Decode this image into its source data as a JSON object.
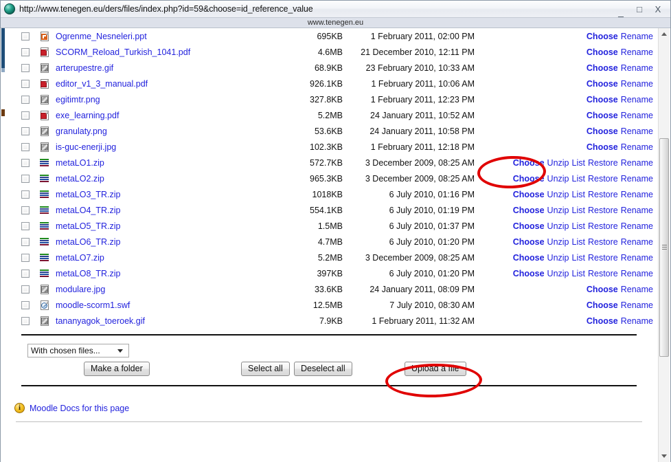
{
  "browser": {
    "favicon": "globe-orb-icon",
    "url": "http://www.tenegen.eu/ders/files/index.php?id=59&choose=id_reference_value",
    "host_strip": "www.tenegen.eu",
    "controls": {
      "minimize": "_",
      "maximize": "□",
      "close": "X"
    }
  },
  "files": [
    {
      "name": "Ogrenme_Nesneleri.ppt",
      "icon": "powerpoint-file-icon",
      "type": "ppt",
      "size": "695KB",
      "date": "1 February 2011, 02:00 PM",
      "actions": [
        "Choose",
        "Rename"
      ]
    },
    {
      "name": "SCORM_Reload_Turkish_1041.pdf",
      "icon": "pdf-file-icon",
      "type": "pdf",
      "size": "4.6MB",
      "date": "21 December 2010, 12:11 PM",
      "actions": [
        "Choose",
        "Rename"
      ]
    },
    {
      "name": "arterupestre.gif",
      "icon": "image-file-icon",
      "type": "img",
      "size": "68.9KB",
      "date": "23 February 2010, 10:33 AM",
      "actions": [
        "Choose",
        "Rename"
      ]
    },
    {
      "name": "editor_v1_3_manual.pdf",
      "icon": "pdf-file-icon",
      "type": "pdf",
      "size": "926.1KB",
      "date": "1 February 2011, 10:06 AM",
      "actions": [
        "Choose",
        "Rename"
      ]
    },
    {
      "name": "egitimtr.png",
      "icon": "image-file-icon",
      "type": "img",
      "size": "327.8KB",
      "date": "1 February 2011, 12:23 PM",
      "actions": [
        "Choose",
        "Rename"
      ]
    },
    {
      "name": "exe_learning.pdf",
      "icon": "pdf-file-icon",
      "type": "pdf",
      "size": "5.2MB",
      "date": "24 January 2011, 10:52 AM",
      "actions": [
        "Choose",
        "Rename"
      ]
    },
    {
      "name": "granulaty.png",
      "icon": "image-file-icon",
      "type": "img",
      "size": "53.6KB",
      "date": "24 January 2011, 10:58 PM",
      "actions": [
        "Choose",
        "Rename"
      ]
    },
    {
      "name": "is-guc-enerji.jpg",
      "icon": "image-file-icon",
      "type": "img",
      "size": "102.3KB",
      "date": "1 February 2011, 12:18 PM",
      "actions": [
        "Choose",
        "Rename"
      ]
    },
    {
      "name": "metaLO1.zip",
      "icon": "zip-file-icon",
      "type": "zip",
      "size": "572.7KB",
      "date": "3 December 2009, 08:25 AM",
      "actions": [
        "Choose",
        "Unzip",
        "List",
        "Restore",
        "Rename"
      ]
    },
    {
      "name": "metaLO2.zip",
      "icon": "zip-file-icon",
      "type": "zip",
      "size": "965.3KB",
      "date": "3 December 2009, 08:25 AM",
      "actions": [
        "Choose",
        "Unzip",
        "List",
        "Restore",
        "Rename"
      ]
    },
    {
      "name": "metaLO3_TR.zip",
      "icon": "zip-file-icon",
      "type": "zip",
      "size": "1018KB",
      "date": "6 July 2010, 01:16 PM",
      "actions": [
        "Choose",
        "Unzip",
        "List",
        "Restore",
        "Rename"
      ]
    },
    {
      "name": "metaLO4_TR.zip",
      "icon": "zip-file-icon",
      "type": "zip",
      "size": "554.1KB",
      "date": "6 July 2010, 01:19 PM",
      "actions": [
        "Choose",
        "Unzip",
        "List",
        "Restore",
        "Rename"
      ]
    },
    {
      "name": "metaLO5_TR.zip",
      "icon": "zip-file-icon",
      "type": "zip",
      "size": "1.5MB",
      "date": "6 July 2010, 01:37 PM",
      "actions": [
        "Choose",
        "Unzip",
        "List",
        "Restore",
        "Rename"
      ]
    },
    {
      "name": "metaLO6_TR.zip",
      "icon": "zip-file-icon",
      "type": "zip",
      "size": "4.7MB",
      "date": "6 July 2010, 01:20 PM",
      "actions": [
        "Choose",
        "Unzip",
        "List",
        "Restore",
        "Rename"
      ]
    },
    {
      "name": "metaLO7.zip",
      "icon": "zip-file-icon",
      "type": "zip",
      "size": "5.2MB",
      "date": "3 December 2009, 08:25 AM",
      "actions": [
        "Choose",
        "Unzip",
        "List",
        "Restore",
        "Rename"
      ]
    },
    {
      "name": "metaLO8_TR.zip",
      "icon": "zip-file-icon",
      "type": "zip",
      "size": "397KB",
      "date": "6 July 2010, 01:20 PM",
      "actions": [
        "Choose",
        "Unzip",
        "List",
        "Restore",
        "Rename"
      ]
    },
    {
      "name": "modulare.jpg",
      "icon": "image-file-icon",
      "type": "img",
      "size": "33.6KB",
      "date": "24 January 2011, 08:09 PM",
      "actions": [
        "Choose",
        "Rename"
      ]
    },
    {
      "name": "moodle-scorm1.swf",
      "icon": "flash-file-icon",
      "type": "swf",
      "size": "12.5MB",
      "date": "7 July 2010, 08:30 AM",
      "actions": [
        "Choose",
        "Rename"
      ]
    },
    {
      "name": "tananyagok_toeroek.gif",
      "icon": "image-file-icon",
      "type": "img",
      "size": "7.9KB",
      "date": "1 February 2011, 11:32 AM",
      "actions": [
        "Choose",
        "Rename"
      ]
    }
  ],
  "controls": {
    "with_chosen_label": "With chosen files...",
    "make_folder": "Make a folder",
    "select_all": "Select all",
    "deselect_all": "Deselect all",
    "upload_file": "Upload a file"
  },
  "footer": {
    "docs_link": "Moodle Docs for this page",
    "info_icon": "info-circle-icon"
  },
  "annotations": {
    "accent_color": "#e00000",
    "highlighted": [
      "Choose",
      "Upload a file"
    ]
  }
}
